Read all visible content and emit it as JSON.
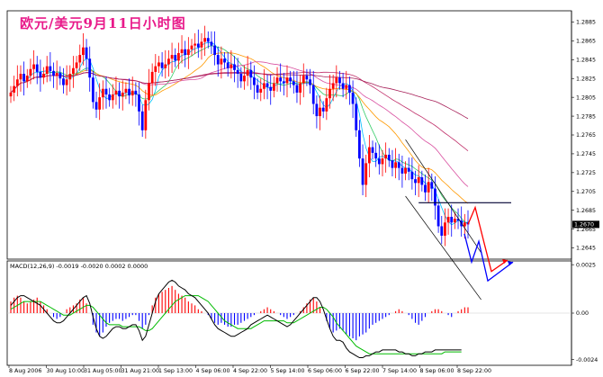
{
  "window": {
    "title": "欧元/美元9月11日小时图"
  },
  "price_panel": {
    "price_axis_labels": [
      "1.2885",
      "1.2865",
      "1.2845",
      "1.2825",
      "1.2805",
      "1.2785",
      "1.2765",
      "1.2745",
      "1.2725",
      "1.2705",
      "1.2685",
      "1.2670",
      "1.2665",
      "1.2645"
    ],
    "current_price": "1.2670"
  },
  "macd_panel": {
    "label": "MACD(12,26,9) -0.0019 -0.0020 0.0002 0.0000",
    "axis_labels": [
      "0.0025",
      "0.00",
      "-0.0024"
    ]
  },
  "time_axis_labels": [
    "8 Aug 2006",
    "30 Aug 10:00",
    "31 Aug 05:00",
    "31 Aug 21:00",
    "1 Sep 13:00",
    "4 Sep 06:00",
    "4 Sep 22:00",
    "5 Sep 14:00",
    "6 Sep 06:00",
    "6 Sep 22:00",
    "7 Sep 14:00",
    "8 Sep 06:00",
    "8 Sep 22:00"
  ],
  "colors": {
    "title": "#e81a8a",
    "bull_candle": "#ff0000",
    "bear_candle": "#0000ff",
    "macd_pos": "#ff0000",
    "macd_neg": "#0000ff",
    "signal": "#00bb00",
    "macd_line": "#000000",
    "forecast_red": "#ff0000",
    "forecast_blue": "#0000ff"
  },
  "chart_data": {
    "type": "candlestick",
    "title": "欧元/美元9月11日小时图",
    "ylim": [
      1.2635,
      1.2895
    ],
    "closes": [
      1.281,
      1.2817,
      1.2824,
      1.283,
      1.2822,
      1.2828,
      1.2835,
      1.284,
      1.2832,
      1.2826,
      1.283,
      1.2838,
      1.2833,
      1.2828,
      1.2831,
      1.2825,
      1.2818,
      1.2824,
      1.283,
      1.2836,
      1.2842,
      1.285,
      1.2858,
      1.2846,
      1.2826,
      1.28,
      1.2792,
      1.2805,
      1.2814,
      1.2808,
      1.2802,
      1.2808,
      1.2812,
      1.2806,
      1.281,
      1.2814,
      1.2807,
      1.2812,
      1.2808,
      1.279,
      1.277,
      1.2802,
      1.282,
      1.2832,
      1.2838,
      1.2842,
      1.2836,
      1.284,
      1.2846,
      1.285,
      1.2844,
      1.2852,
      1.2856,
      1.285,
      1.2856,
      1.286,
      1.2862,
      1.2858,
      1.2864,
      1.2868,
      1.2864,
      1.286,
      1.285,
      1.284,
      1.2846,
      1.2842,
      1.2836,
      1.284,
      1.2834,
      1.283,
      1.2822,
      1.2828,
      1.2834,
      1.2826,
      1.2818,
      1.281,
      1.2814,
      1.282,
      1.2816,
      1.2812,
      1.282,
      1.2826,
      1.2822,
      1.282,
      1.2826,
      1.2822,
      1.2818,
      1.281,
      1.282,
      1.2828,
      1.2824,
      1.2818,
      1.2798,
      1.2785,
      1.2794,
      1.279,
      1.2804,
      1.2814,
      1.282,
      1.2826,
      1.282,
      1.2814,
      1.2818,
      1.281,
      1.2798,
      1.277,
      1.274,
      1.2712,
      1.2735,
      1.2752,
      1.2746,
      1.274,
      1.2734,
      1.274,
      1.2744,
      1.2738,
      1.273,
      1.2736,
      1.273,
      1.2724,
      1.273,
      1.2726,
      1.2718,
      1.2714,
      1.272,
      1.2712,
      1.2704,
      1.2715,
      1.2708,
      1.269,
      1.2668,
      1.2658,
      1.2672,
      1.2678,
      1.2672,
      1.2676,
      1.2674,
      1.2668,
      1.2672,
      1.267
    ],
    "ma_periods": [
      5,
      10,
      20,
      34,
      55,
      89
    ],
    "channel": {
      "upper": [
        [
          120,
          1.276
        ],
        [
          143,
          1.264
        ]
      ],
      "lower": [
        [
          120,
          1.27
        ],
        [
          143,
          1.259
        ]
      ]
    },
    "resistance": 1.2693,
    "macd_hist": [
      0.0006,
      0.0008,
      0.0009,
      0.0008,
      0.0006,
      0.0005,
      0.0006,
      0.0007,
      0.0008,
      0.0006,
      0.0004,
      0.0002,
      0.0,
      -0.0002,
      -0.0003,
      -0.0002,
      0.0,
      0.0002,
      0.0003,
      0.0004,
      0.0005,
      0.0007,
      0.0008,
      0.0005,
      0.0,
      -0.0006,
      -0.001,
      -0.0012,
      -0.001,
      -0.0007,
      -0.0005,
      -0.0004,
      -0.0003,
      -0.0003,
      -0.0004,
      -0.0003,
      -0.0002,
      -0.0001,
      -0.0001,
      -0.0004,
      -0.0008,
      -0.0006,
      -0.0001,
      0.0004,
      0.0008,
      0.001,
      0.0011,
      0.0012,
      0.0013,
      0.0014,
      0.0012,
      0.001,
      0.0009,
      0.0008,
      0.0006,
      0.0005,
      0.0004,
      0.0002,
      0.0001,
      0.0,
      -0.0001,
      -0.0003,
      -0.0005,
      -0.0006,
      -0.0005,
      -0.0006,
      -0.0007,
      -0.0007,
      -0.0006,
      -0.0006,
      -0.0005,
      -0.0004,
      -0.0003,
      -0.0002,
      -0.0001,
      0.0,
      0.0001,
      0.0002,
      0.0003,
      0.0002,
      0.0001,
      0.0,
      -0.0001,
      -0.0002,
      -0.0003,
      -0.0002,
      -0.0001,
      0.0,
      0.0001,
      0.0003,
      0.0005,
      0.0007,
      0.0008,
      0.0006,
      0.0003,
      0.0,
      -0.0004,
      -0.0008,
      -0.001,
      -0.0009,
      -0.0008,
      -0.0009,
      -0.0011,
      -0.0012,
      -0.0013,
      -0.0014,
      -0.0012,
      -0.0011,
      -0.001,
      -0.0008,
      -0.0006,
      -0.0005,
      -0.0004,
      -0.0003,
      -0.0002,
      -0.0001,
      0.0,
      0.0001,
      0.0002,
      0.0001,
      0.0,
      -0.0001,
      -0.0003,
      -0.0005,
      -0.0006,
      -0.0004,
      -0.0002,
      0.0,
      0.0001,
      0.0002,
      0.0002,
      0.0001,
      0.0,
      -0.0001,
      -0.0002,
      0.0,
      0.0001,
      0.0002,
      0.0003,
      0.0003
    ],
    "macd_line": [
      0.0004,
      0.0006,
      0.0008,
      0.0009,
      0.0009,
      0.0008,
      0.0007,
      0.0006,
      0.0005,
      0.0004,
      0.0002,
      0.0,
      -0.0002,
      -0.0004,
      -0.0005,
      -0.0005,
      -0.0004,
      -0.0002,
      0.0,
      0.0002,
      0.0004,
      0.0006,
      0.0008,
      0.0009,
      0.0005,
      -0.0002,
      -0.0008,
      -0.0012,
      -0.0013,
      -0.0012,
      -0.001,
      -0.0008,
      -0.0007,
      -0.0007,
      -0.0008,
      -0.0008,
      -0.0007,
      -0.0006,
      -0.0006,
      -0.0009,
      -0.0014,
      -0.0012,
      -0.0006,
      0.0,
      0.0006,
      0.001,
      0.0012,
      0.0014,
      0.0016,
      0.0017,
      0.0016,
      0.0014,
      0.0013,
      0.0012,
      0.001,
      0.0009,
      0.0008,
      0.0006,
      0.0004,
      0.0002,
      0.0,
      -0.0003,
      -0.0006,
      -0.0008,
      -0.0009,
      -0.001,
      -0.0011,
      -0.0012,
      -0.0012,
      -0.0011,
      -0.001,
      -0.0009,
      -0.0008,
      -0.0006,
      -0.0005,
      -0.0004,
      -0.0003,
      -0.0002,
      -0.0001,
      -0.0002,
      -0.0003,
      -0.0004,
      -0.0005,
      -0.0006,
      -0.0007,
      -0.0006,
      -0.0004,
      -0.0002,
      0.0,
      0.0002,
      0.0004,
      0.0006,
      0.0008,
      0.0008,
      0.0006,
      0.0002,
      -0.0003,
      -0.0008,
      -0.0012,
      -0.0014,
      -0.0014,
      -0.0015,
      -0.0018,
      -0.002,
      -0.0021,
      -0.0022,
      -0.0023,
      -0.0023,
      -0.0022,
      -0.0022,
      -0.0021,
      -0.002,
      -0.002,
      -0.0019,
      -0.0019,
      -0.0019,
      -0.0019,
      -0.0019,
      -0.002,
      -0.002,
      -0.0021,
      -0.0021,
      -0.0022,
      -0.0022,
      -0.0021,
      -0.0021,
      -0.002,
      -0.002,
      -0.002,
      -0.0019,
      -0.0019,
      -0.0019,
      -0.0019,
      -0.0019,
      -0.0019,
      -0.0019,
      -0.0019,
      -0.0019
    ],
    "signal_line": [
      0.0002,
      0.0003,
      0.0004,
      0.0005,
      0.0006,
      0.0006,
      0.0006,
      0.0006,
      0.0006,
      0.0006,
      0.0005,
      0.0004,
      0.0003,
      0.0002,
      0.0001,
      0.0,
      -0.0001,
      -0.0001,
      -0.0001,
      0.0,
      0.0001,
      0.0002,
      0.0003,
      0.0004,
      0.0004,
      0.0003,
      0.0001,
      -0.0001,
      -0.0003,
      -0.0005,
      -0.0006,
      -0.0006,
      -0.0006,
      -0.0006,
      -0.0007,
      -0.0007,
      -0.0007,
      -0.0007,
      -0.0007,
      -0.0007,
      -0.0008,
      -0.0009,
      -0.0009,
      -0.0008,
      -0.0006,
      -0.0004,
      -0.0002,
      0.0,
      0.0002,
      0.0004,
      0.0006,
      0.0007,
      0.0008,
      0.0009,
      0.0009,
      0.0009,
      0.0009,
      0.0009,
      0.0008,
      0.0007,
      0.0006,
      0.0004,
      0.0002,
      0.0,
      -0.0002,
      -0.0004,
      -0.0005,
      -0.0006,
      -0.0007,
      -0.0008,
      -0.0008,
      -0.0008,
      -0.0008,
      -0.0008,
      -0.0007,
      -0.0006,
      -0.0005,
      -0.0004,
      -0.0004,
      -0.0004,
      -0.0004,
      -0.0004,
      -0.0004,
      -0.0004,
      -0.0005,
      -0.0005,
      -0.0005,
      -0.0004,
      -0.0003,
      -0.0002,
      -0.0001,
      0.0,
      0.0001,
      0.0002,
      0.0003,
      0.0003,
      0.0002,
      0.0,
      -0.0002,
      -0.0005,
      -0.0007,
      -0.0009,
      -0.0011,
      -0.0013,
      -0.0015,
      -0.0017,
      -0.0018,
      -0.0019,
      -0.002,
      -0.0021,
      -0.0021,
      -0.0021,
      -0.0021,
      -0.0021,
      -0.0021,
      -0.0021,
      -0.0021,
      -0.0021,
      -0.0021,
      -0.0021,
      -0.0021,
      -0.0021,
      -0.0021,
      -0.0021,
      -0.0021,
      -0.0021,
      -0.0021,
      -0.0021,
      -0.0021,
      -0.0021,
      -0.0021,
      -0.0021,
      -0.002,
      -0.002,
      -0.002,
      -0.002,
      -0.002,
      -0.002
    ],
    "macd_ylim": [
      -0.0026,
      0.0026
    ]
  }
}
